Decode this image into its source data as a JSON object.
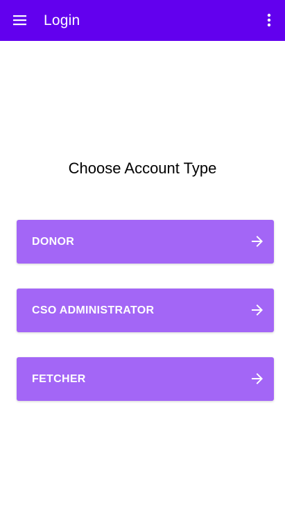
{
  "app_bar": {
    "title": "Login",
    "menu_icon": "hamburger-menu-icon",
    "overflow_icon": "more-vert-icon",
    "color": "#6200ee"
  },
  "main": {
    "heading": "Choose Account Type",
    "accounts": [
      {
        "label": "DONOR",
        "icon": "arrow-right-icon"
      },
      {
        "label": "CSO ADMINISTRATOR",
        "icon": "arrow-right-icon"
      },
      {
        "label": "FETCHER",
        "icon": "arrow-right-icon"
      }
    ],
    "button_color": "#a366f6"
  }
}
